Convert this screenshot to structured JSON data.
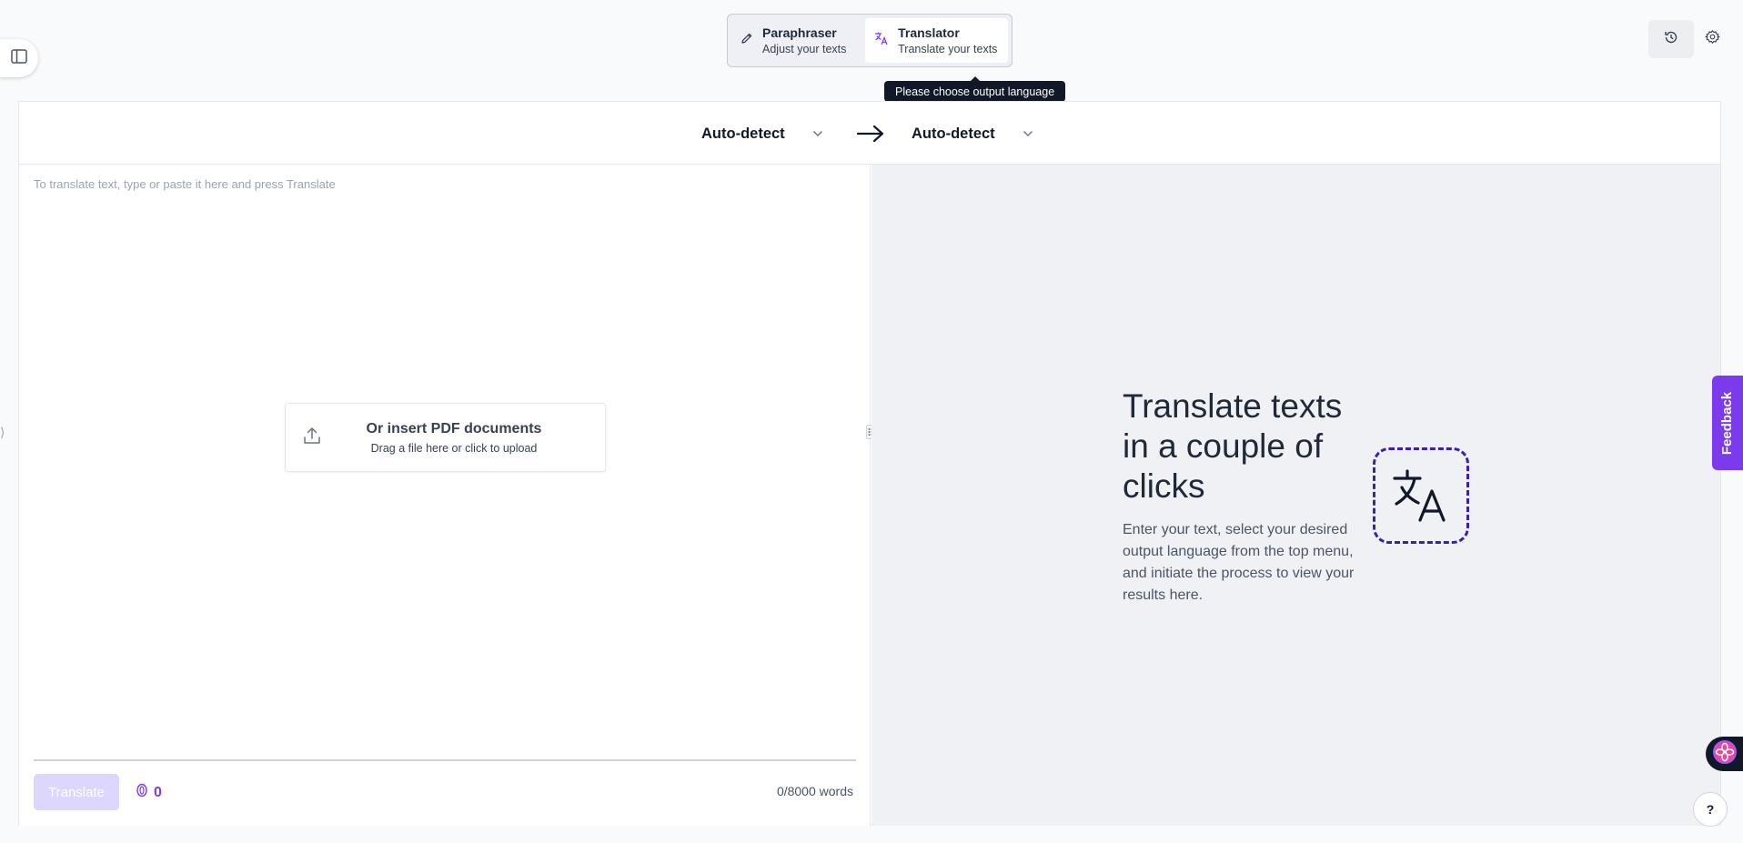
{
  "mode_switch": {
    "paraphraser": {
      "title": "Paraphraser",
      "subtitle": "Adjust your texts",
      "icon": "pencil-icon"
    },
    "translator": {
      "title": "Translator",
      "subtitle": "Translate your texts",
      "icon": "translate-icon",
      "active": true
    }
  },
  "tooltip": {
    "text": "Please choose output language"
  },
  "languages": {
    "source": "Auto-detect",
    "target": "Auto-detect",
    "arrow_icon": "arrow-right-icon"
  },
  "input": {
    "placeholder": "To translate text, type or paste it here and press Translate",
    "value": ""
  },
  "pdf_upload": {
    "title": "Or insert PDF documents",
    "subtitle": "Drag a file here or click to upload",
    "icon": "upload-icon"
  },
  "footer": {
    "translate_label": "Translate",
    "credits": "0",
    "word_count": "0/8000 words"
  },
  "output": {
    "title": "Translate texts in a couple of clicks",
    "description": "Enter your text, select your desired output language from the top menu, and initiate the process to view your results here.",
    "icon": "translate-icon"
  },
  "feedback": {
    "label": "Feedback"
  },
  "help": {
    "label": "?"
  },
  "colors": {
    "accent": "#7c3aed",
    "accent_light": "#ddd6fe",
    "icon_border": "#3b1fae",
    "output_bg": "#f0f1f5"
  }
}
